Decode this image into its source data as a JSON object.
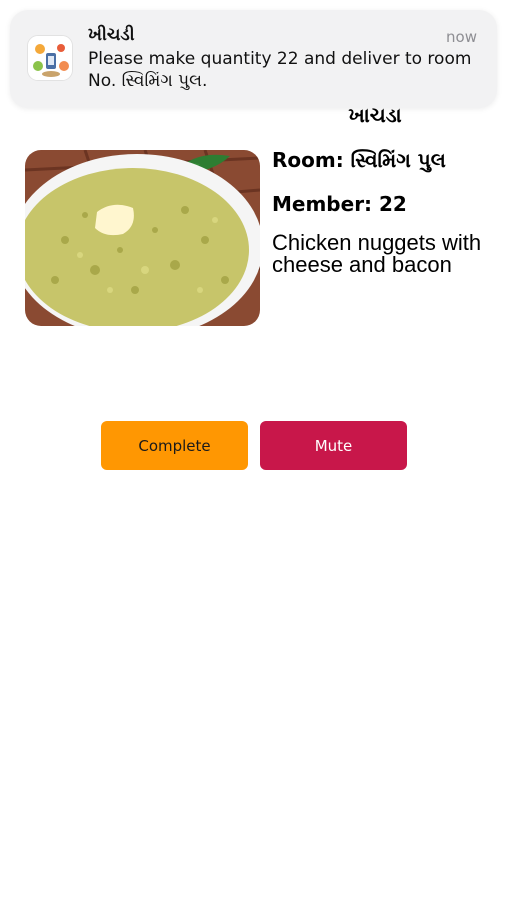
{
  "notification": {
    "app_name": "ખીચડી",
    "time": "now",
    "message": "Please make quantity 22 and deliver to room No. સ્વિમિંગ પુલ.",
    "icon": "food-app-icon"
  },
  "order": {
    "title": "ખાચડા",
    "room": "Room: સ્વિમિંગ પુલ",
    "member": "Member: 22",
    "description": "Chicken nuggets with cheese and bacon",
    "image": "khichdi-bowl-photo"
  },
  "actions": {
    "complete_label": "Complete",
    "mute_label": "Mute"
  },
  "colors": {
    "complete": "#ff9702",
    "mute": "#c8174a",
    "banner": "#f2f2f3"
  }
}
